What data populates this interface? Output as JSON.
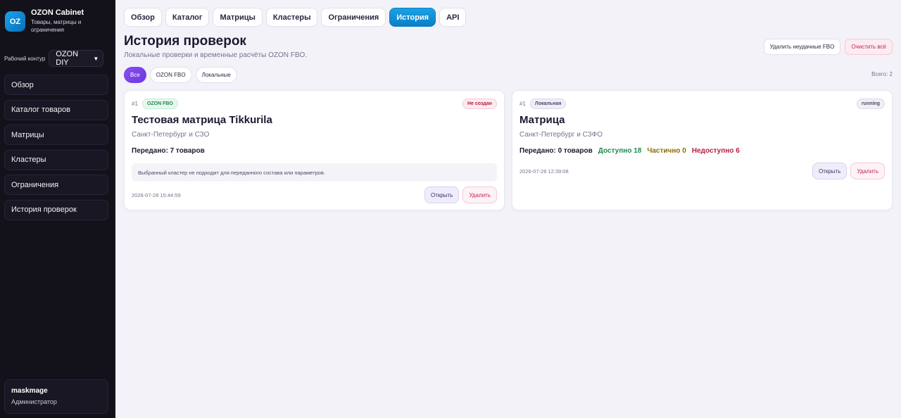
{
  "brand": {
    "logo_text": "OZ",
    "title": "OZON Cabinet",
    "subtitle": "Товары, матрицы и ограничения"
  },
  "workspace": {
    "label": "Рабочий контур",
    "selected": "OZON DIY"
  },
  "sidebar": {
    "items": [
      {
        "label": "Обзор"
      },
      {
        "label": "Каталог товаров"
      },
      {
        "label": "Матрицы"
      },
      {
        "label": "Кластеры"
      },
      {
        "label": "Ограничения"
      },
      {
        "label": "История проверок"
      }
    ]
  },
  "user": {
    "name": "maskmage",
    "role": "Администратор"
  },
  "tabs": [
    {
      "label": "Обзор",
      "active": false
    },
    {
      "label": "Каталог",
      "active": false
    },
    {
      "label": "Матрицы",
      "active": false
    },
    {
      "label": "Кластеры",
      "active": false
    },
    {
      "label": "Ограничения",
      "active": false
    },
    {
      "label": "История",
      "active": true
    },
    {
      "label": "API",
      "active": false
    }
  ],
  "page": {
    "title": "История проверок",
    "subtitle": "Локальные проверки и временные расчёты OZON FBO.",
    "delete_failed_label": "Удалить неудачные FBO",
    "clear_all_label": "Очистить всё",
    "total_label": "Всего: 2"
  },
  "filters": [
    {
      "label": "Все",
      "active": true
    },
    {
      "label": "OZON FBO",
      "active": false
    },
    {
      "label": "Локальные",
      "active": false
    }
  ],
  "cards": [
    {
      "num": "#1",
      "type_badge": "OZON FBO",
      "status_badge": "Не создан",
      "title": "Тестовая матрица Tikkurila",
      "region": "Санкт-Петербург и СЗО",
      "transferred": "Передано: 7 товаров",
      "note": "Выбранный кластер не подходит для переданного состава или параметров.",
      "timestamp": "2026-07-28 15:44:59",
      "open_label": "Открыть",
      "delete_label": "Удалить"
    },
    {
      "num": "#1",
      "type_badge": "Локальная",
      "status_badge": "running",
      "title": "Матрица",
      "region": "Санкт-Петербург и СЗФО",
      "transferred": "Передано: 0 товаров",
      "available": "Доступно 18",
      "partial": "Частично 0",
      "unavailable": "Недоступно 6",
      "timestamp": "2026-07-28 12:39:08",
      "open_label": "Открыть",
      "delete_label": "Удалить"
    }
  ],
  "colors": {
    "sidebar_bg": "#13121b",
    "accent_blue": "#0a7fc4",
    "accent_purple": "#7a42ea",
    "danger": "#c0274f",
    "success": "#1c8a4c",
    "warning": "#8a6c00"
  }
}
